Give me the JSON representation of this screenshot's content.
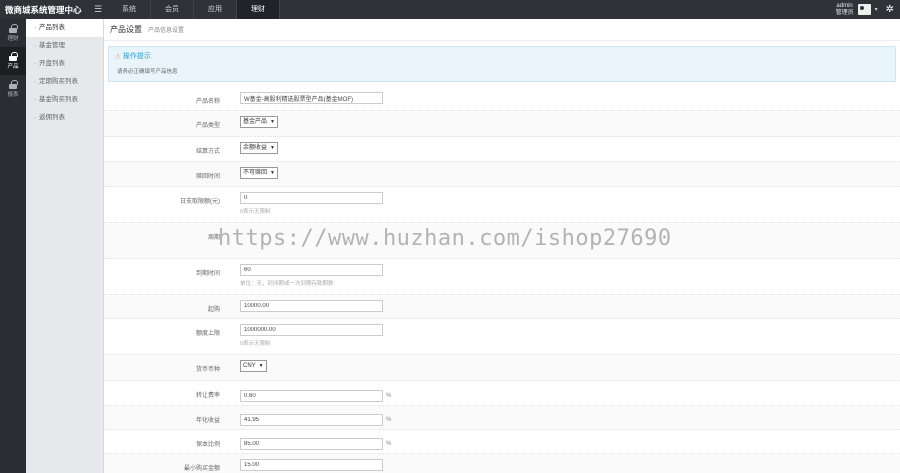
{
  "app": {
    "title": "微商城系统管理中心",
    "menu_icon": "hamburger-icon"
  },
  "top_nav": [
    {
      "label": "系统"
    },
    {
      "label": "会员"
    },
    {
      "label": "应用"
    },
    {
      "label": "理财"
    }
  ],
  "user": {
    "name": "admin",
    "role": "管理员"
  },
  "left_tabs": [
    {
      "label": "理财",
      "icon": "lock-icon"
    },
    {
      "label": "产品",
      "icon": "lock-icon"
    },
    {
      "label": "报表",
      "icon": "lock-icon"
    }
  ],
  "submenu": [
    {
      "label": "产品列表"
    },
    {
      "label": "基金管理"
    },
    {
      "label": "开盘列表"
    },
    {
      "label": "定期购买列表"
    },
    {
      "label": "基金购买列表"
    },
    {
      "label": "返佣列表"
    }
  ],
  "page": {
    "title": "产品设置",
    "subtitle": "产品信息设置"
  },
  "tips": {
    "title": "操作提示",
    "text": "请务必正确填写产品信息"
  },
  "form": {
    "product_name": {
      "label": "产品名称",
      "value": "W基金-高股利精选股票型产品(基金MOF)"
    },
    "product_type": {
      "label": "产品类型",
      "value": "基金产品"
    },
    "fee_mode": {
      "label": "结算方式",
      "value": "余额收益"
    },
    "redeem": {
      "label": "赎回时间",
      "value": "不可赎回"
    },
    "daily_limit": {
      "label": "日支取限额(元)",
      "value": "0",
      "hint": "0表示无限制"
    },
    "period": {
      "label": "周期"
    },
    "close_time": {
      "label": "到期时间",
      "value": "60",
      "hint": "单位：天，封闭期或一次到期存款期数"
    },
    "min_amount": {
      "label": "起购",
      "value": "10000.00"
    },
    "max_amount": {
      "label": "额度上限",
      "value": "1000000.00",
      "hint": "0表示无限制"
    },
    "currency": {
      "label": "货币币种",
      "value": "CNY"
    },
    "fee_rate": {
      "label": "转让费率",
      "value": "0.60",
      "unit": "%"
    },
    "annual_rate": {
      "label": "年化收益",
      "value": "41.95",
      "unit": "%"
    },
    "capital_ratio": {
      "label": "保本比例",
      "value": "85.00",
      "unit": "%"
    },
    "last": {
      "label": "最小购买金额",
      "value": "15.00"
    }
  },
  "watermark": "https://www.huzhan.com/ishop27690"
}
